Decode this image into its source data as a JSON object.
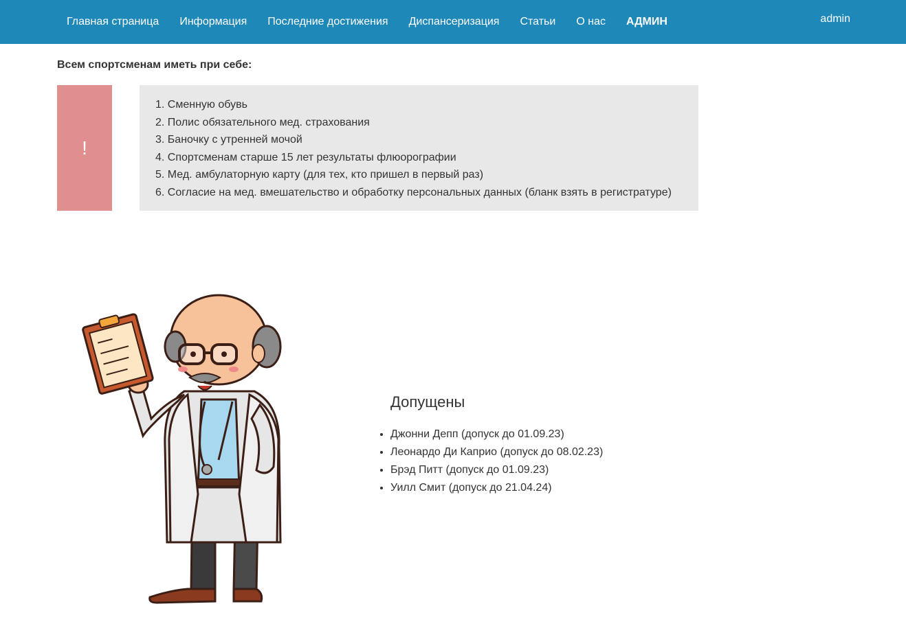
{
  "nav": {
    "items": [
      {
        "label": "Главная страница",
        "active": false
      },
      {
        "label": "Информация",
        "active": false
      },
      {
        "label": "Последние достижения",
        "active": false
      },
      {
        "label": "Диспансеризация",
        "active": false
      },
      {
        "label": "Статьи",
        "active": false
      },
      {
        "label": "О нас",
        "active": false
      },
      {
        "label": "АДМИН",
        "active": true
      }
    ],
    "user": "admin",
    "color": "#1e88b8"
  },
  "notice": {
    "heading": "Всем спортсменам иметь при себе:",
    "mark": "!",
    "mark_color": "#e08f8f",
    "items": [
      "1. Сменную обувь",
      "2. Полис обязательного мед. страхования",
      "3. Баночку с утренней мочой",
      "4. Спортсменам старше 15 лет результаты флюорографии",
      "5. Мед. амбулаторную карту (для тех, кто пришел в первый раз)",
      "6. Согласие на мед. вмешательство и обработку персональных данных (бланк взять в регистратуре)"
    ]
  },
  "illustration": {
    "icon": "doctor-with-clipboard-illustration"
  },
  "allowed": {
    "title": "Допущены",
    "items": [
      "Джонни Депп (допуск до 01.09.23)",
      "Леонардо Ди Каприо (допуск до 08.02.23)",
      "Брэд Питт (допуск до 01.09.23)",
      "Уилл Смит (допуск до 21.04.24)"
    ]
  }
}
